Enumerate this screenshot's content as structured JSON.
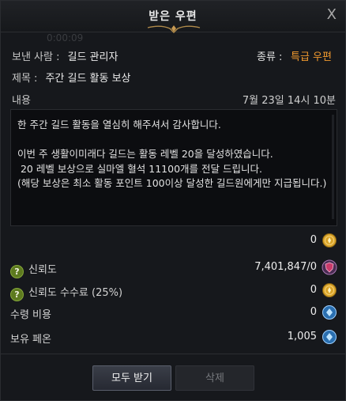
{
  "window": {
    "title": "받은 우편",
    "close_glyph": "X",
    "ghost_text": "0:00:09"
  },
  "mail": {
    "sender_label": "보낸 사람 :",
    "sender": "길드 관리자",
    "kind_label": "종류 :",
    "kind": "특급 우편",
    "subject_label": "제목 :",
    "subject": "주간 길드 활동 보상",
    "content_label": "내용",
    "date": "7월 23일 14시 10분",
    "body": "한 주간 길드 활동을 열심히 해주셔서 감사합니다.\n\n이번 주 생활이미래다 길드는 활동 레벨 20을 달성하였습니다.\n 20 레벨 보상으로 실마엘 혈석 11100개를 전달 드립니다.\n(해당 보상은 최소 활동 포인트 100이상 달성한 길드원에게만 지급됩니다.)"
  },
  "attachments": {
    "gold": {
      "value": "0",
      "icon": "gold-coin-icon"
    },
    "trust": {
      "label": "신뢰도",
      "value": "7,401,847/0",
      "icon": "guild-shield-icon"
    },
    "trust_fee": {
      "label": "신뢰도 수수료 (25%)",
      "value": "0",
      "icon": "gold-coin-icon"
    },
    "receive_cost": {
      "label": "수령 비용",
      "value": "0",
      "icon": "blue-crystal-icon"
    },
    "owned_phon": {
      "label": "보유 페온",
      "value": "1,005",
      "icon": "blue-crystal-icon"
    },
    "help_glyph": "?"
  },
  "buttons": {
    "receive_all": "모두 받기",
    "delete": "삭제"
  },
  "colors": {
    "accent_orange": "#f29a2e",
    "help_green": "#5d7a1f",
    "background": "#16181c"
  }
}
